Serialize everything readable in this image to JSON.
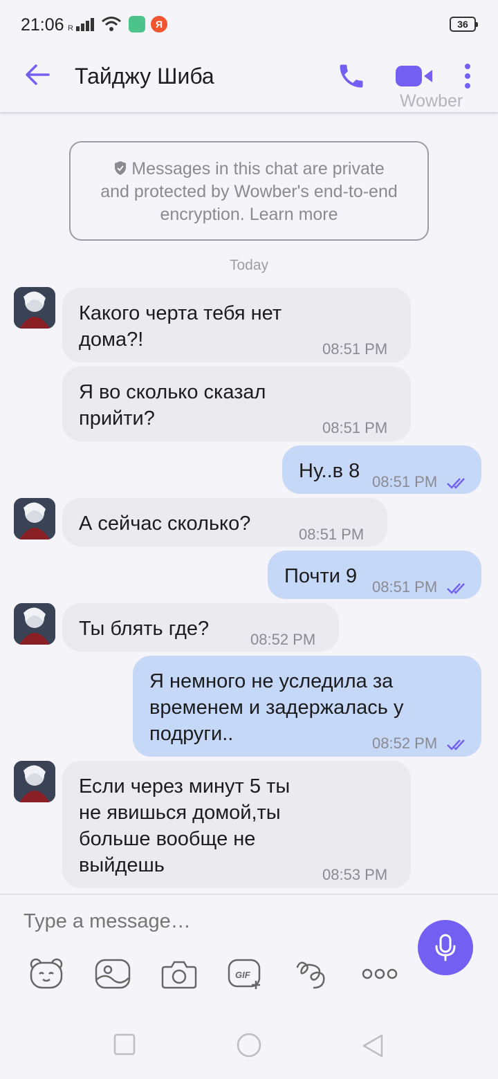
{
  "status": {
    "time": "21:06",
    "network": "R",
    "app2_glyph": "Я",
    "battery": "36"
  },
  "header": {
    "title": "Тайджу Шиба",
    "watermark": "Wowber"
  },
  "notice": {
    "text": "Messages in this chat are private and protected by Wowber's end-to-end encryption. Learn more",
    "line1": "Messages in this chat are private",
    "line2": "and protected by Wowber's end-to-end",
    "line3": "encryption. Learn more"
  },
  "date_separator": "Today",
  "messages": [
    {
      "dir": "in",
      "lines": [
        "Какого черта тебя нет",
        "дома?!"
      ],
      "time": "08:51 PM"
    },
    {
      "dir": "in",
      "lines": [
        "Я во сколько сказал",
        "прийти?"
      ],
      "time": "08:51 PM"
    },
    {
      "dir": "out",
      "lines": [
        "Ну..в 8"
      ],
      "time": "08:51 PM",
      "status": "read"
    },
    {
      "dir": "in",
      "lines": [
        "А сейчас сколько?"
      ],
      "time": "08:51 PM"
    },
    {
      "dir": "out",
      "lines": [
        "Почти 9"
      ],
      "time": "08:51 PM",
      "status": "read"
    },
    {
      "dir": "in",
      "lines": [
        "Ты блять где?"
      ],
      "time": "08:52 PM"
    },
    {
      "dir": "out",
      "lines": [
        "Я немного не уследила за",
        "временем и задержалась у",
        "подруги.."
      ],
      "time": "08:52 PM",
      "status": "read"
    },
    {
      "dir": "in",
      "lines": [
        "Если через минут 5 ты",
        "не явишься домой,ты",
        "больше вообще не",
        "выйдешь"
      ],
      "time": "08:53 PM"
    }
  ],
  "composer": {
    "placeholder": "Type a message…",
    "tools": [
      "sticker-icon",
      "gallery-icon",
      "camera-icon",
      "gif-icon",
      "doodle-icon",
      "more-dots-icon"
    ]
  },
  "colors": {
    "accent": "#7360f2",
    "incoming_bubble": "#ebeaee",
    "outgoing_bubble": "#c6d8f7",
    "background": "#f5f4f8"
  }
}
